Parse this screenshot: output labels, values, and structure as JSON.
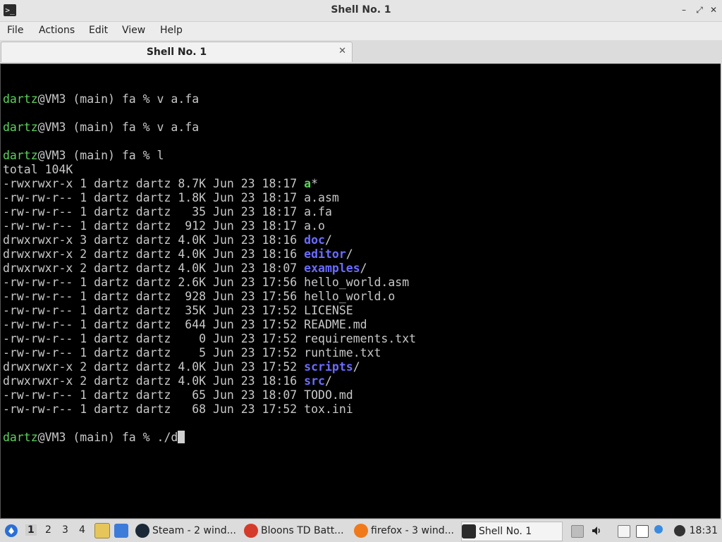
{
  "window": {
    "title": "Shell No. 1",
    "app_icon": "terminal-icon",
    "controls": [
      "minimize",
      "maximize",
      "close"
    ]
  },
  "menu": [
    "File",
    "Actions",
    "Edit",
    "View",
    "Help"
  ],
  "tab": {
    "label": "Shell No. 1",
    "close_icon": "close-icon"
  },
  "terminal": {
    "lines": [
      {
        "kind": "blank"
      },
      {
        "kind": "prompt",
        "user": "dartz",
        "rest": "@VM3 (main) fa % v a.fa"
      },
      {
        "kind": "blank"
      },
      {
        "kind": "prompt",
        "user": "dartz",
        "rest": "@VM3 (main) fa % v a.fa"
      },
      {
        "kind": "blank"
      },
      {
        "kind": "prompt",
        "user": "dartz",
        "rest": "@VM3 (main) fa % l"
      },
      {
        "kind": "text",
        "text": "total 104K"
      },
      {
        "kind": "ls",
        "prefix": "-rwxrwxr-x 1 dartz dartz 8.7K Jun 23 18:17 ",
        "name": "a",
        "style": "exe",
        "suffix": "*"
      },
      {
        "kind": "ls",
        "prefix": "-rw-rw-r-- 1 dartz dartz 1.8K Jun 23 18:17 ",
        "name": "a.asm",
        "style": "plain",
        "suffix": ""
      },
      {
        "kind": "ls",
        "prefix": "-rw-rw-r-- 1 dartz dartz   35 Jun 23 18:17 ",
        "name": "a.fa",
        "style": "plain",
        "suffix": ""
      },
      {
        "kind": "ls",
        "prefix": "-rw-rw-r-- 1 dartz dartz  912 Jun 23 18:17 ",
        "name": "a.o",
        "style": "plain",
        "suffix": ""
      },
      {
        "kind": "ls",
        "prefix": "drwxrwxr-x 3 dartz dartz 4.0K Jun 23 18:16 ",
        "name": "doc",
        "style": "dir",
        "suffix": "/"
      },
      {
        "kind": "ls",
        "prefix": "drwxrwxr-x 2 dartz dartz 4.0K Jun 23 18:16 ",
        "name": "editor",
        "style": "dir",
        "suffix": "/"
      },
      {
        "kind": "ls",
        "prefix": "drwxrwxr-x 2 dartz dartz 4.0K Jun 23 18:07 ",
        "name": "examples",
        "style": "dir",
        "suffix": "/"
      },
      {
        "kind": "ls",
        "prefix": "-rw-rw-r-- 1 dartz dartz 2.6K Jun 23 17:56 ",
        "name": "hello_world.asm",
        "style": "plain",
        "suffix": ""
      },
      {
        "kind": "ls",
        "prefix": "-rw-rw-r-- 1 dartz dartz  928 Jun 23 17:56 ",
        "name": "hello_world.o",
        "style": "plain",
        "suffix": ""
      },
      {
        "kind": "ls",
        "prefix": "-rw-rw-r-- 1 dartz dartz  35K Jun 23 17:52 ",
        "name": "LICENSE",
        "style": "plain",
        "suffix": ""
      },
      {
        "kind": "ls",
        "prefix": "-rw-rw-r-- 1 dartz dartz  644 Jun 23 17:52 ",
        "name": "README.md",
        "style": "plain",
        "suffix": ""
      },
      {
        "kind": "ls",
        "prefix": "-rw-rw-r-- 1 dartz dartz    0 Jun 23 17:52 ",
        "name": "requirements.txt",
        "style": "plain",
        "suffix": ""
      },
      {
        "kind": "ls",
        "prefix": "-rw-rw-r-- 1 dartz dartz    5 Jun 23 17:52 ",
        "name": "runtime.txt",
        "style": "plain",
        "suffix": ""
      },
      {
        "kind": "ls",
        "prefix": "drwxrwxr-x 2 dartz dartz 4.0K Jun 23 17:52 ",
        "name": "scripts",
        "style": "dir",
        "suffix": "/"
      },
      {
        "kind": "ls",
        "prefix": "drwxrwxr-x 2 dartz dartz 4.0K Jun 23 18:16 ",
        "name": "src",
        "style": "dir",
        "suffix": "/"
      },
      {
        "kind": "ls",
        "prefix": "-rw-rw-r-- 1 dartz dartz   65 Jun 23 18:07 ",
        "name": "TODO.md",
        "style": "plain",
        "suffix": ""
      },
      {
        "kind": "ls",
        "prefix": "-rw-rw-r-- 1 dartz dartz   68 Jun 23 17:52 ",
        "name": "tox.ini",
        "style": "plain",
        "suffix": ""
      },
      {
        "kind": "blank"
      },
      {
        "kind": "prompt",
        "user": "dartz",
        "rest": "@VM3 (main) fa % ./d",
        "cursor": true
      }
    ]
  },
  "taskbar": {
    "start_icon": "start-menu-icon",
    "workspaces": [
      "1",
      "2",
      "3",
      "4"
    ],
    "active_workspace": "1",
    "launchers": [
      "file-manager-icon",
      "show-desktop-icon"
    ],
    "tasks": [
      {
        "label": "Steam - 2 wind...",
        "icon": "steam-icon",
        "active": false
      },
      {
        "label": "Bloons TD Batt...",
        "icon": "bloons-icon",
        "active": false
      },
      {
        "label": "firefox - 3 wind...",
        "icon": "firefox-icon",
        "active": false
      },
      {
        "label": "Shell No. 1",
        "icon": "terminal-icon",
        "active": true
      }
    ],
    "tray": [
      "disk-icon",
      "volume-icon",
      "clipboard-icon",
      "network-icon",
      "steam-tray-icon"
    ],
    "clock": "18:31"
  }
}
